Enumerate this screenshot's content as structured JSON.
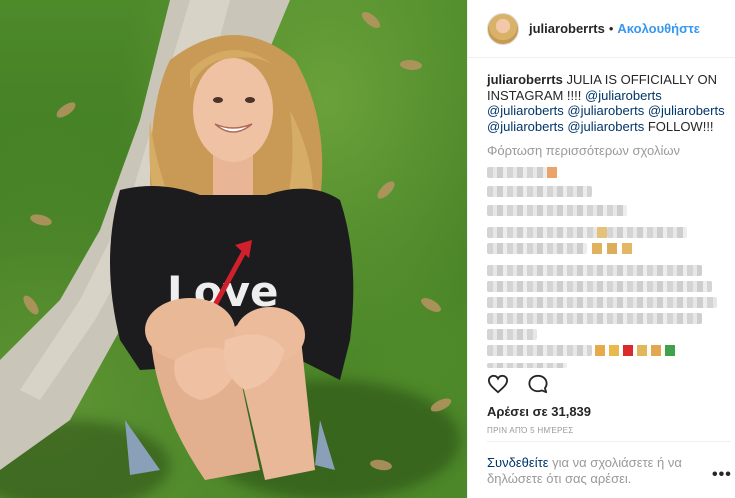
{
  "post": {
    "username": "juliaroberrts",
    "separator": "•",
    "follow_label": "Ακολουθήστε",
    "caption": {
      "author": "juliaroberrts",
      "text": "JULIA IS OFFICIALLY ON INSTAGRAM !!!!",
      "tags": [
        "@juliaroberts",
        "@juliaroberts",
        "@juliaroberts",
        "@juliaroberts",
        "@juliaroberts",
        "@juliaroberts"
      ],
      "suffix": "FOLLOW!!!"
    },
    "load_more_comments": "Φόρτωση περισσότερων σχολίων",
    "likes_label": "Αρέσει σε 31,839",
    "time_ago": "ΠΡΙΝ ΑΠΌ 5 ΗΜΈΡΕΣ",
    "login_link": "Συνδεθείτε",
    "login_text": "για να σχολιάσετε ή να δηλώσετε ότι σας αρέσει.",
    "more_options": "•••",
    "sweater_text": "Love"
  },
  "icons": {
    "like": "heart-icon",
    "comment": "comment-icon",
    "more": "more-options-icon"
  },
  "colors": {
    "link_blue": "#3897f0",
    "tag_blue": "#003569",
    "muted": "#999999",
    "sweater_arrow": "#d0202c"
  }
}
